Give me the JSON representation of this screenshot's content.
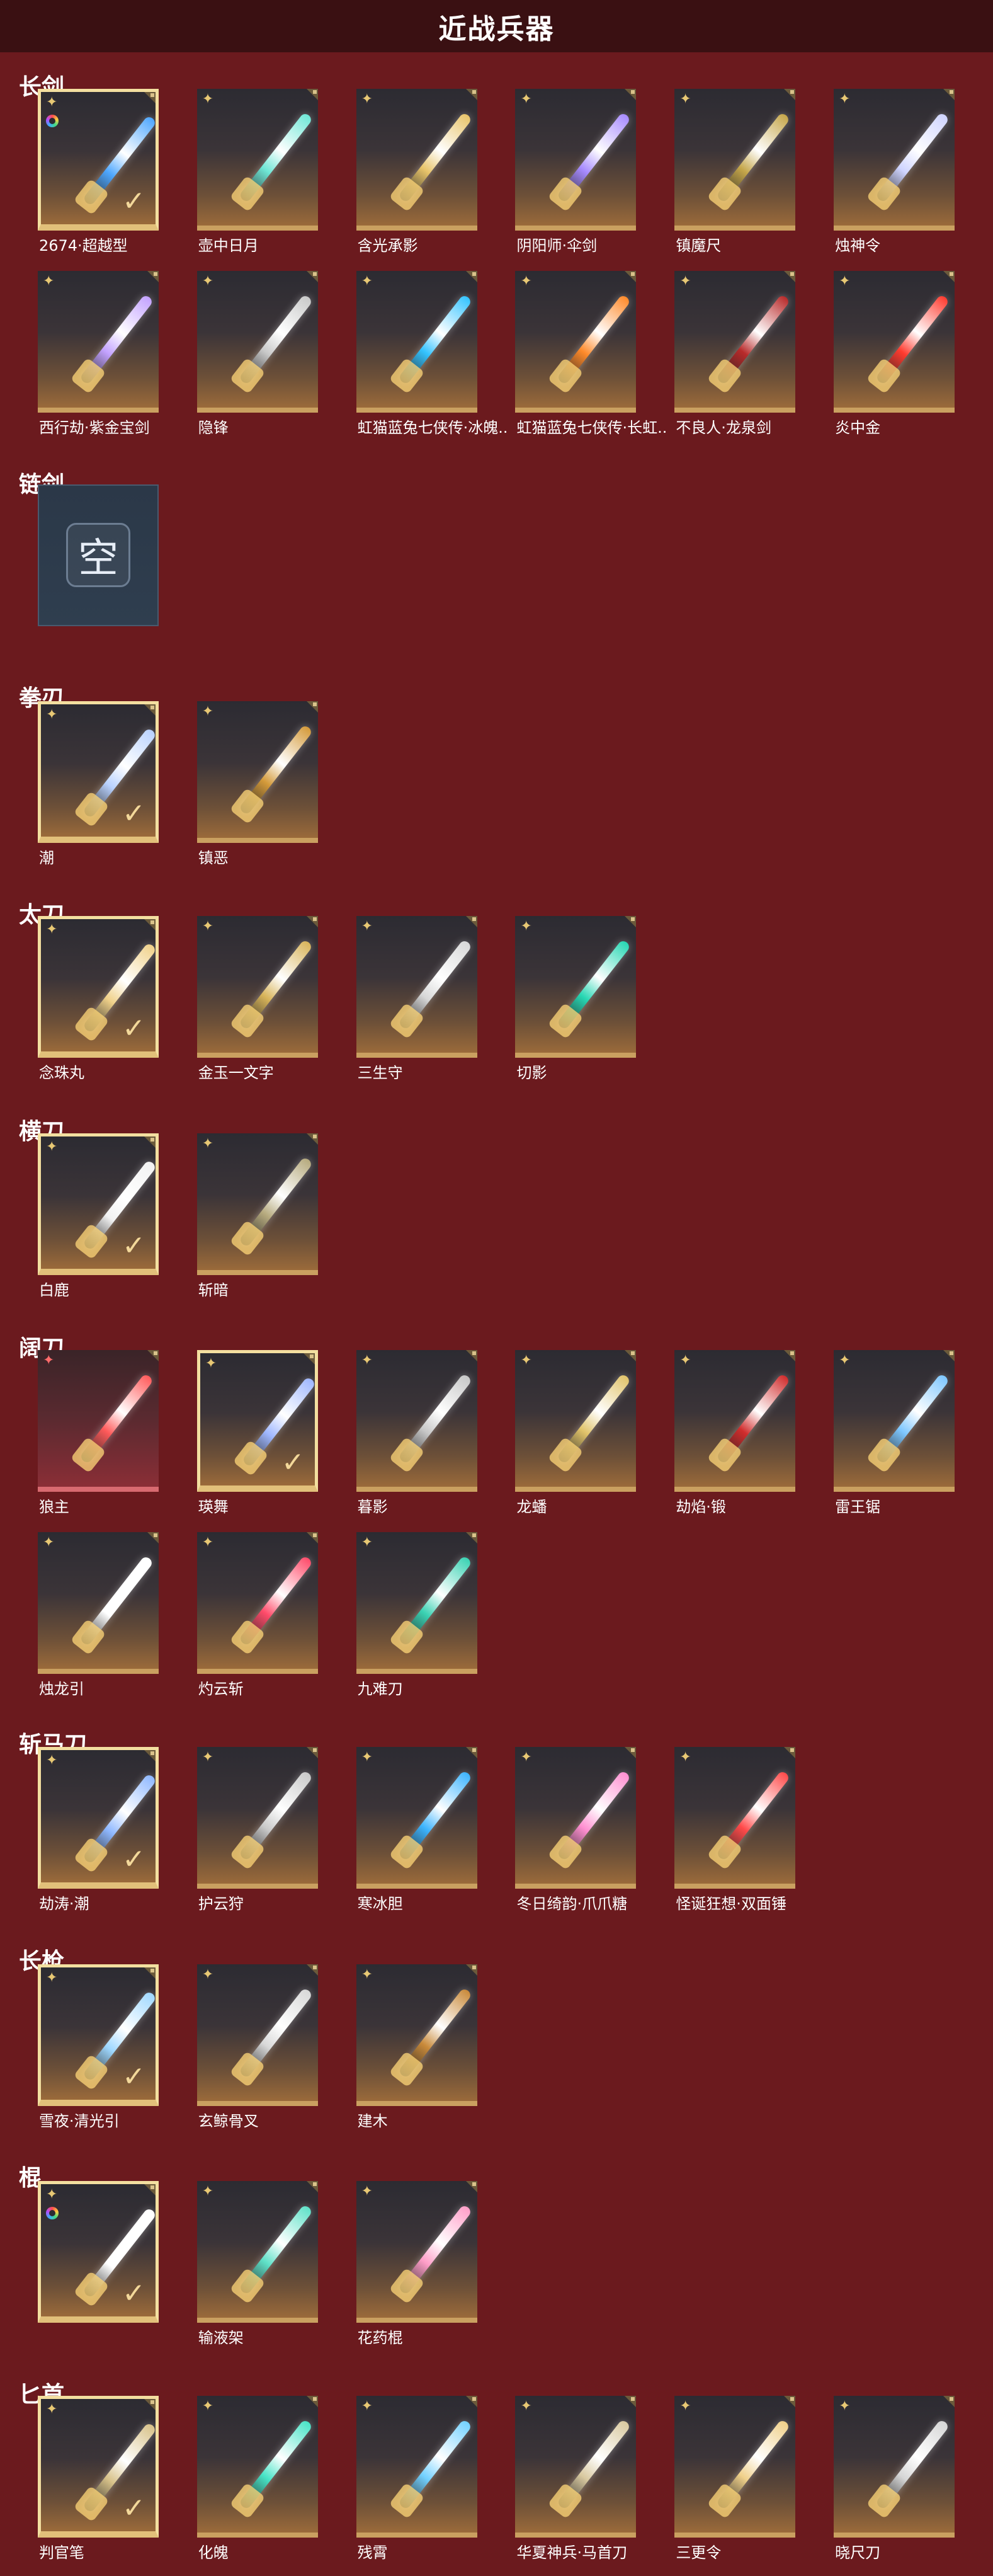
{
  "header": {
    "title": "近战兵器"
  },
  "colors": {
    "page_bg": "#6b1a1e",
    "header_bg": "#3a1012",
    "gold": "#caa060",
    "red": "#d86a70"
  },
  "categories": [
    {
      "title": "长剑",
      "items": [
        {
          "name": "2674·超越型",
          "rank": "gold",
          "selected": true,
          "rainbow": true,
          "accent": "#4ea7ff"
        },
        {
          "name": "壶中日月",
          "rank": "gold",
          "accent": "#6fe7d6"
        },
        {
          "name": "含光承影",
          "rank": "gold",
          "accent": "#e8c46a"
        },
        {
          "name": "阴阳师·伞剑",
          "rank": "gold",
          "accent": "#a78bff"
        },
        {
          "name": "镇魔尺",
          "rank": "gold",
          "accent": "#c5a64a"
        },
        {
          "name": "烛神令",
          "rank": "gold",
          "accent": "#cfd4ff"
        },
        {
          "name": "西行劫·紫金宝剑",
          "rank": "gold",
          "accent": "#c3a2ff"
        },
        {
          "name": "隐锋",
          "rank": "gold",
          "accent": "#c9c9c9"
        },
        {
          "name": "虹猫蓝兔七侠传·冰魄...",
          "rank": "gold",
          "accent": "#34c3ff"
        },
        {
          "name": "虹猫蓝兔七侠传·长虹...",
          "rank": "gold",
          "accent": "#ff8a2a"
        },
        {
          "name": "不良人·龙泉剑",
          "rank": "gold",
          "accent": "#b82a2a"
        },
        {
          "name": "炎中金",
          "rank": "gold",
          "accent": "#ff3b2f"
        }
      ]
    },
    {
      "title": "链剑",
      "items": [
        {
          "name": "",
          "empty": true,
          "empty_glyph": "空"
        }
      ]
    },
    {
      "title": "拳刃",
      "items": [
        {
          "name": "潮",
          "rank": "gold",
          "selected": true,
          "accent": "#b9d2ff"
        },
        {
          "name": "镇恶",
          "rank": "gold",
          "accent": "#d49a3a"
        }
      ]
    },
    {
      "title": "太刀",
      "items": [
        {
          "name": "念珠丸",
          "rank": "gold",
          "selected": true,
          "accent": "#f0d18a"
        },
        {
          "name": "金玉一文字",
          "rank": "gold",
          "accent": "#d8b45a"
        },
        {
          "name": "三生守",
          "rank": "gold",
          "accent": "#d8d8d8"
        },
        {
          "name": "切影",
          "rank": "gold",
          "accent": "#27d7b3"
        }
      ]
    },
    {
      "title": "横刀",
      "items": [
        {
          "name": "白鹿",
          "rank": "gold",
          "selected": true,
          "accent": "#f2f2f2"
        },
        {
          "name": "斩暗",
          "rank": "gold",
          "accent": "#b6aa7e"
        }
      ]
    },
    {
      "title": "阔刀",
      "items": [
        {
          "name": "狼主",
          "rank": "red",
          "red_tile": true,
          "accent": "#ff5a5a"
        },
        {
          "name": "瑛舞",
          "rank": "gold",
          "selected": true,
          "accent": "#9fb7ff"
        },
        {
          "name": "暮影",
          "rank": "gold",
          "accent": "#c7c7c7"
        },
        {
          "name": "龙蟠",
          "rank": "gold",
          "accent": "#e1c36a"
        },
        {
          "name": "劫焰·锻",
          "rank": "gold",
          "accent": "#d12c2c"
        },
        {
          "name": "雷王锯",
          "rank": "gold",
          "accent": "#7ec7ff"
        },
        {
          "name": "烛龙引",
          "rank": "gold",
          "accent": "#ffffff"
        },
        {
          "name": "灼云斩",
          "rank": "gold",
          "accent": "#ff4b6a"
        },
        {
          "name": "九难刀",
          "rank": "gold",
          "accent": "#3ad2b3"
        }
      ]
    },
    {
      "title": "斩马刀",
      "items": [
        {
          "name": "劫涛·潮",
          "rank": "gold",
          "selected": true,
          "accent": "#8fb8ff"
        },
        {
          "name": "护云狩",
          "rank": "gold",
          "accent": "#c9c9c9"
        },
        {
          "name": "寒冰胆",
          "rank": "gold",
          "accent": "#3db4ff"
        },
        {
          "name": "冬日绮韵·爪爪糖",
          "rank": "gold",
          "accent": "#ff8fd1"
        },
        {
          "name": "怪诞狂想·双面锤",
          "rank": "gold",
          "accent": "#ff4a4a"
        }
      ]
    },
    {
      "title": "长枪",
      "items": [
        {
          "name": "雪夜·清光引",
          "rank": "gold",
          "selected": true,
          "accent": "#9fd8ff"
        },
        {
          "name": "玄鲸骨叉",
          "rank": "gold",
          "accent": "#d8d8d8"
        },
        {
          "name": "建木",
          "rank": "gold",
          "accent": "#c98a3a"
        }
      ]
    },
    {
      "title": "棍",
      "items": [
        {
          "name": "",
          "rank": "gold",
          "selected": true,
          "rainbow": true,
          "accent": "#ffffff"
        },
        {
          "name": "输液架",
          "rank": "gold",
          "accent": "#5fe1c8"
        },
        {
          "name": "花药棍",
          "rank": "gold",
          "accent": "#ff9ec8"
        }
      ]
    },
    {
      "title": "匕首",
      "items": [
        {
          "name": "判官笔",
          "rank": "gold",
          "selected": true,
          "accent": "#d8c28a"
        },
        {
          "name": "化魄",
          "rank": "gold",
          "accent": "#48e4c7"
        },
        {
          "name": "残霄",
          "rank": "gold",
          "accent": "#73d1ff"
        },
        {
          "name": "华夏神兵·马首刀",
          "rank": "gold",
          "accent": "#d9c9a0"
        },
        {
          "name": "三更令",
          "rank": "gold",
          "accent": "#f0d08a"
        },
        {
          "name": "晓尺刀",
          "rank": "gold",
          "accent": "#d6d6d6"
        }
      ]
    }
  ]
}
